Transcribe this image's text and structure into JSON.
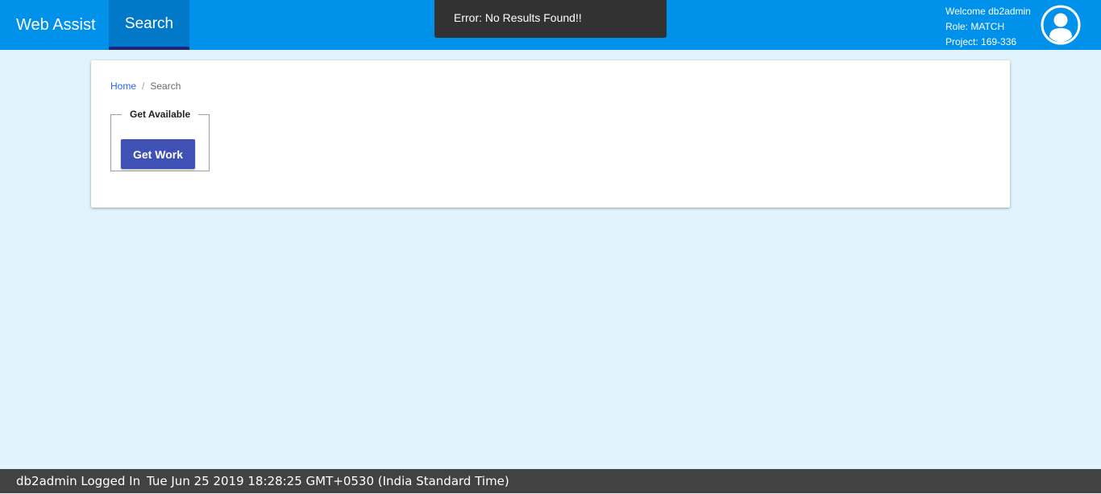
{
  "header": {
    "brand": "Web Assist",
    "nav_tab": "Search",
    "user": {
      "welcome": "Welcome db2admin",
      "role": "Role: MATCH",
      "project": "Project: 169-336",
      "avatar_icon": "user-avatar-icon"
    }
  },
  "toast": {
    "message": "Error: No Results Found!!"
  },
  "breadcrumb": {
    "home": "Home",
    "separator": "/",
    "current": "Search"
  },
  "get_available": {
    "legend": "Get Available",
    "button_label": "Get Work"
  },
  "footer": {
    "login_status": "db2admin Logged In",
    "timestamp": "Tue Jun 25 2019 18:28:25 GMT+0530 (India Standard Time)"
  },
  "colors": {
    "header_bg": "#0091ea",
    "active_tab_bg": "#0278c8",
    "page_bg": "#e1f4fd",
    "button_bg": "#3f51b5",
    "toast_bg": "#323232",
    "footer_bg": "#424242"
  }
}
